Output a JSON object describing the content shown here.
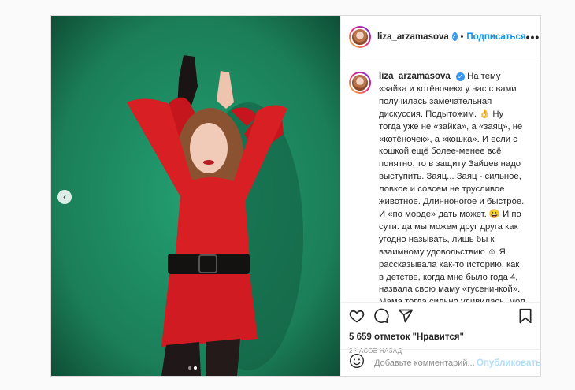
{
  "post": {
    "username": "liza_arzamasova",
    "header_separator": "•",
    "follow_label": "Подписаться",
    "more_label": "•••",
    "caption": "На тему «зайка и котёночек» у нас с вами получилась замечательная дискуссия. Подытожим. 👌 Ну тогда уже не «зайка», а «заяц», не «котёночек», а «кошка». И если с кошкой ещё более-менее всё понятно, то в защиту Зайцев надо выступить. Заяц... Заяц - сильное, ловкое и совсем не трусливое животное. Длинноногое и быстрое. И «по морде» дать может. 😀 И по сути: да мы можем друг друга как угодно называть, лишь бы к взаимному удовольствию ☺ Я рассказывала как-то историю, как в детстве, когда мне было года 4, назвала свою маму «гусеничкой». Мама тогда сильно удивилась, мол - чего это я «гусеничка»? А я ей очень логично",
    "likes": "5 659 отметок \"Нравится\"",
    "time": "2 часов назад",
    "comment_placeholder": "Добавьте комментарий...",
    "publish_label": "Опубликовать",
    "carousel_prev": "‹",
    "carousel": {
      "count": 2,
      "active": 1
    }
  },
  "colors": {
    "accent": "#0095f6",
    "publish_disabled": "#b2dffc",
    "background_green": "#1f8a63",
    "dress_red": "#d81f24"
  },
  "icons": [
    "heart-icon",
    "comment-icon",
    "share-icon",
    "bookmark-icon",
    "emoji-icon",
    "verified-icon",
    "chevron-left-icon"
  ]
}
